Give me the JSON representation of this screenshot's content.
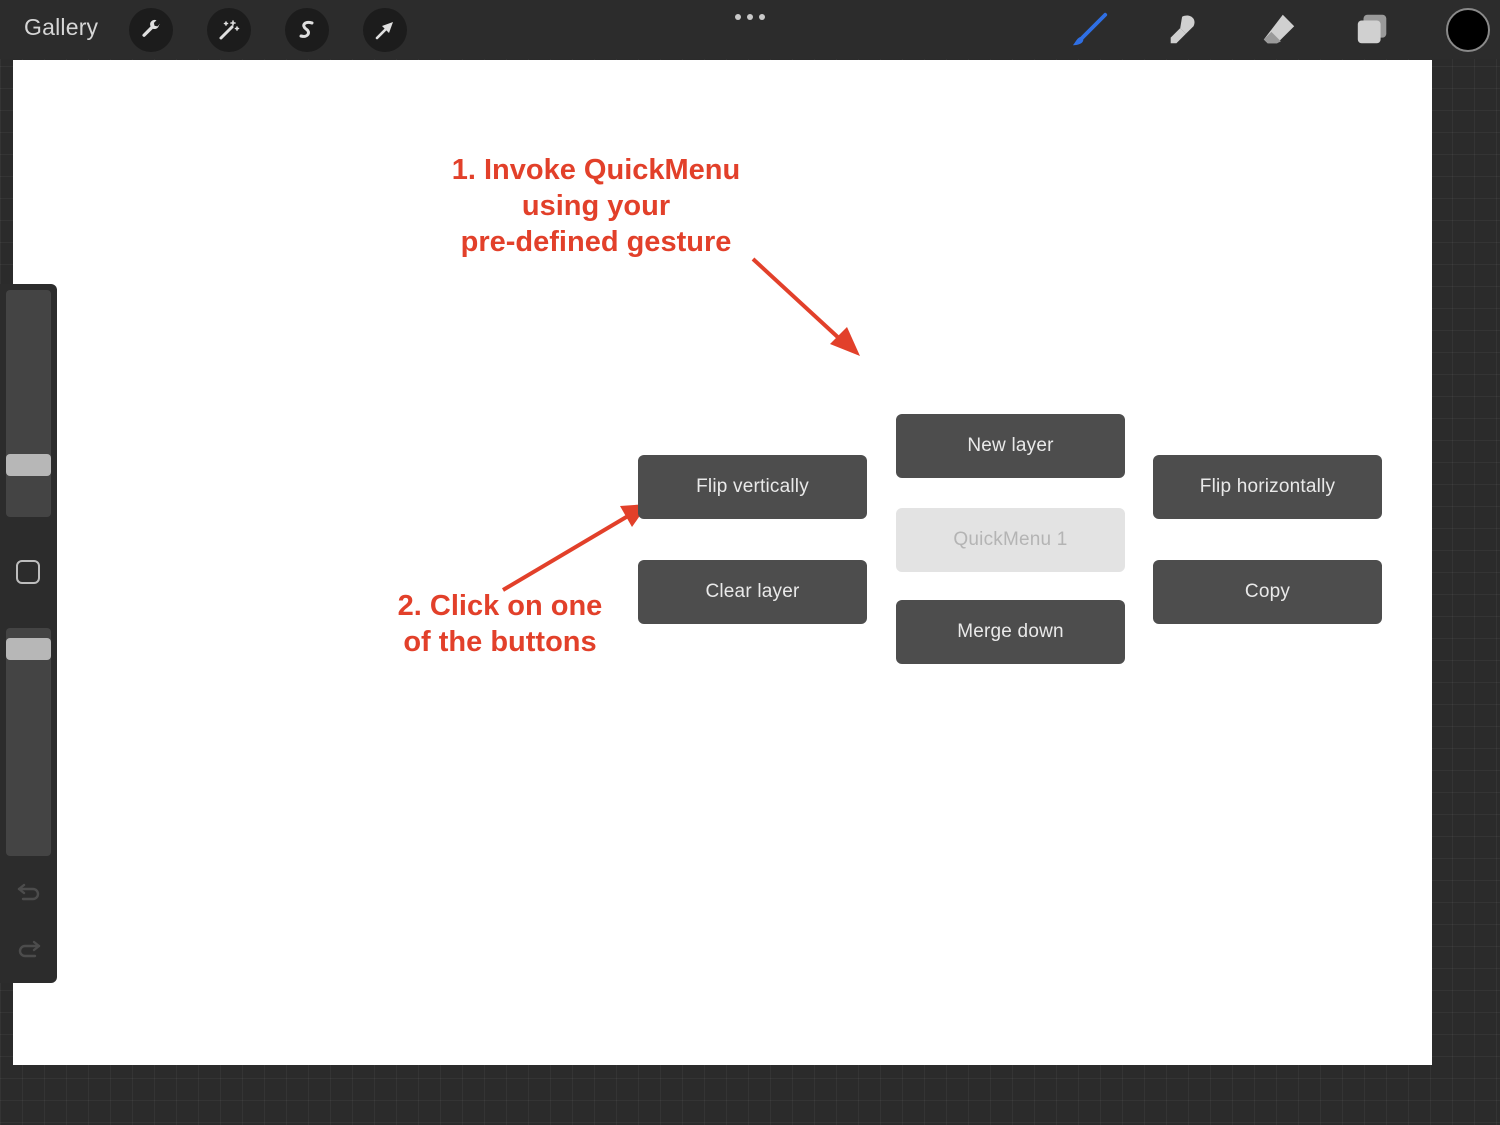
{
  "toolbar": {
    "gallery_label": "Gallery",
    "left_tools": [
      {
        "icon": "wrench-icon"
      },
      {
        "icon": "magic-wand-icon"
      },
      {
        "icon": "selection-s-icon"
      },
      {
        "icon": "arrow-cursor-icon"
      }
    ],
    "right_tools": [
      {
        "icon": "brush-icon",
        "active": true,
        "color": "#2f6fe3"
      },
      {
        "icon": "smudge-icon"
      },
      {
        "icon": "eraser-icon"
      },
      {
        "icon": "layers-icon"
      }
    ],
    "current_color": "#000000"
  },
  "sidebar": {
    "brush_size_level": 0.2,
    "opacity_level": 0.95,
    "undo_icon": "undo-icon",
    "redo_icon": "redo-icon"
  },
  "annotations": {
    "step1": "1. Invoke QuickMenu\nusing your\npre-defined gesture",
    "step2": "2. Click on one\nof the buttons",
    "color": "#e2402a"
  },
  "quickmenu": {
    "title": "QuickMenu 1",
    "top": "New layer",
    "top_left": "Flip vertically",
    "top_right": "Flip horizontally",
    "bottom_left": "Clear layer",
    "bottom_right": "Copy",
    "bottom": "Merge down"
  }
}
